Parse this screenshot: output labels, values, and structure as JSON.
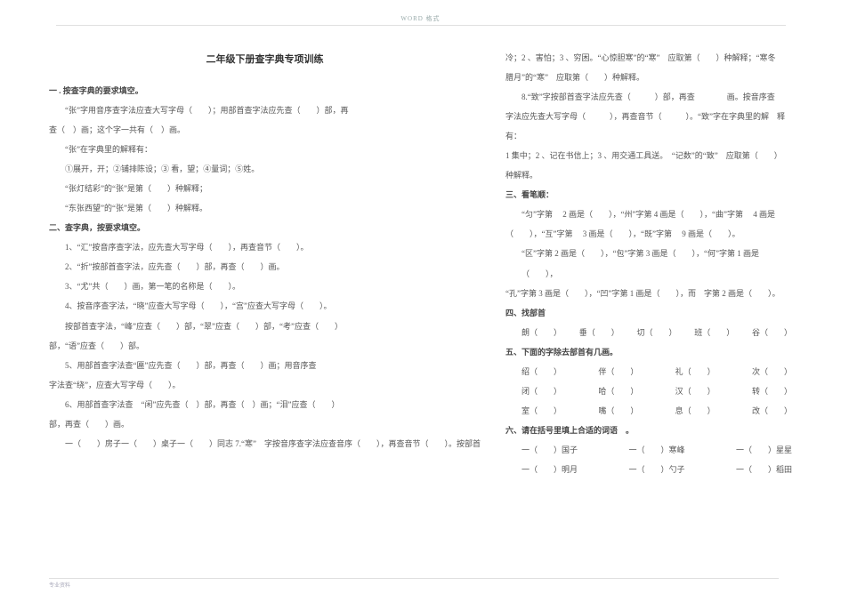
{
  "watermark": "WORD 格式",
  "footer": "专业资料",
  "title": "二年级下册查字典专项训练",
  "left": {
    "s1_heading": "一 . 按查字典的要求填空。",
    "s1_p1": "“张”字用音序查字法应查大写字母（　　）；用部首查字法应先查（　　）部，再",
    "s1_p1b": "查（　）画；这个字一共有（　）画。",
    "s1_p2": "“张”在字典里的解释有：",
    "s1_p3": "①展开，开；②铺排陈设；③ 看，望；④量词；⑤姓。",
    "s1_p4": "“张灯结彩”的“张”是第（　　）种解释；",
    "s1_p5": "“东张西望”的“张”是第（　　）种解释。",
    "s2_heading": "二、查字典，按要求填空。",
    "s2_1": "1、“汇”按音序查字法，应先查大写字母（　　），再查音节（　　）。",
    "s2_2": "2、“折”按部首查字法，应先查（　　）部，再查（　　）画。",
    "s2_3": "3、“尤”共（　　）画，第一笔的名称是（　　）。",
    "s2_4a": "4、按音序查字法，“晓”应查大写字母（　　），“宫”应查大写字母（　　）。",
    "s2_4b": "按部首查字法，“峰”应查（　　）部，“翠”应查（　　）部，“考”应查（　　）",
    "s2_4c": "部，“语”应查（　　）部。",
    "s2_5a": "5、用部首查字法查“匾”应先查（　　）部，再查（　　）画；用音序查",
    "s2_5b": "字法查“绕”，应查大写字母（　　）。",
    "s2_6a": "6、用部首查字法查　“闲”应先查（　）部，再查（　）画；“泪”应查（　　）",
    "s2_6b": "部，再查（　　）画。",
    "s2_last_a": "一（　　）房子",
    "s2_last_b": "一（　　）桌子",
    "s2_last_c": "一（　　）",
    "s2_last_d": "同志 7.“寒”　字按音序查字法应查音序（　　），再查音节（　　）。按部首"
  },
  "right": {
    "r1": "冷；2 、害怕；3 、穷困。“心惊胆寒”的“寒”　应取第（　　）种解释；“寒冬",
    "r2": "腊月”的“寒”　应取第（　　）种解释。",
    "r3": "8.“致”字按部首查字法应先查（　　　）部，再查　　　　画。按音序查",
    "r4": "字法应先查大写字母（　　　），再查音节（　　　）。“致”字在字典里的解　释有：",
    "r5": "1 集中；2 、记在书信上；3 、用交通工具送。　“记数”的“致”　应取第（　　）",
    "r6": "种解释。",
    "s3_heading": "三、看笔顺：",
    "r7": "“匀”字第　 2 画是（　　），“州”字第 4 画是（　　），“曲”字第　 4 画是",
    "r8": "（　　），“互”字第　 3 画是（　　），“既”字第　 9 画是（　　）。",
    "r9": "“区”字第 2 画是（　　），“包”字第 3 画是（　　），“何”字第 1 画是（　　），",
    "r10": "“孔”字第  3 画是（　　），“凹”字第  1 画是（　　），而　字第  2 画是（　　）。",
    "s4_heading": "四、找部首",
    "r11a": "朗（　　）",
    "r11b": "垂（　　）",
    "r11c": "切（　　）",
    "r11d": "班（　　）",
    "r11e": "谷（　　）",
    "s5_heading": "五、下面的字除去部首有几画。",
    "r12a": "绍（　　）",
    "r12b": "伴（　　）",
    "r12c": "礼（　　）",
    "r12d": "次（　　）",
    "r13a": "闭（　　）",
    "r13b": "哈（　　）",
    "r13c": "汉（　　）",
    "r13d": "转（　　）",
    "r14a": "室（　　）",
    "r14b": "嘴（　　）",
    "r14c": "息（　　）",
    "r14d": "改（　　）",
    "s6_heading": "六、请在括号里填上合适的词语　。",
    "r15a": "一（　　）国子",
    "r15b": "一（　　）寒峰",
    "r15c": "一（　　）星星",
    "r16a": "一（　　）明月",
    "r16b": "一（　　）勺子",
    "r16c": "一（　　）稻田"
  }
}
